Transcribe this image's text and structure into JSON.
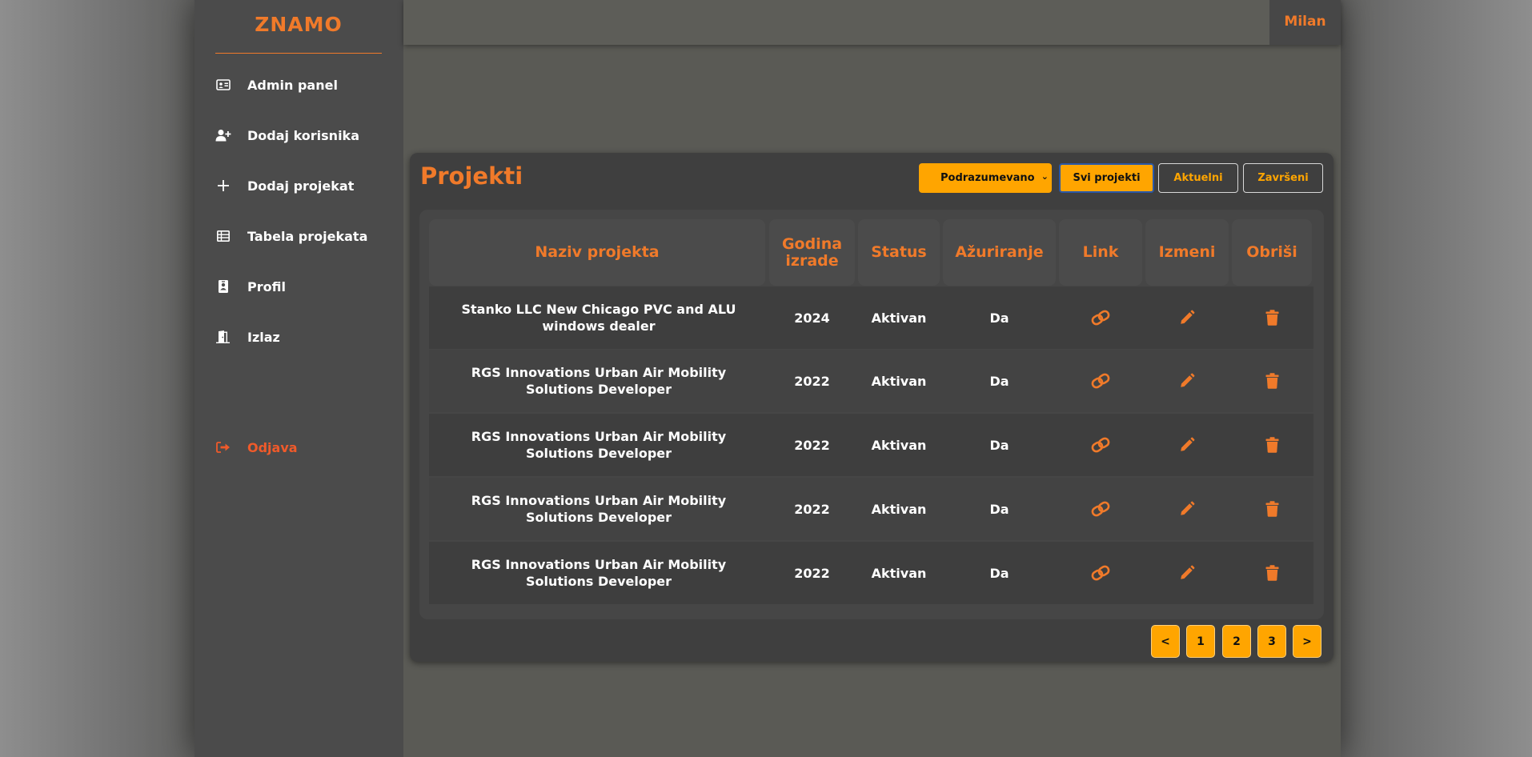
{
  "sidebar": {
    "brand": "ZNAMO",
    "items": [
      {
        "label": "Admin panel",
        "icon": "id-card-icon"
      },
      {
        "label": "Dodaj korisnika",
        "icon": "user-plus-icon"
      },
      {
        "label": "Dodaj projekat",
        "icon": "plus-icon"
      },
      {
        "label": "Tabela projekata",
        "icon": "table-list-icon"
      },
      {
        "label": "Profil",
        "icon": "id-badge-icon"
      },
      {
        "label": "Izlaz",
        "icon": "door-exit-icon"
      }
    ],
    "logout": {
      "label": "Odjava",
      "icon": "sign-out-icon"
    }
  },
  "header": {
    "user": "Milan"
  },
  "projects": {
    "title": "Projekti",
    "sort_selected": "Podrazumevano",
    "filters": [
      "Svi projekti",
      "Aktuelni",
      "Završeni"
    ],
    "active_filter": "Svi projekti",
    "columns": [
      "Naziv projekta",
      "Godina izrade",
      "Status",
      "Ažuriranje",
      "Link",
      "Izmeni",
      "Obriši"
    ],
    "rows": [
      {
        "name": "Stanko LLC New Chicago PVC and ALU windows dealer",
        "year": "2024",
        "status": "Aktivan",
        "update": "Da"
      },
      {
        "name": "RGS Innovations Urban Air Mobility Solutions Developer",
        "year": "2022",
        "status": "Aktivan",
        "update": "Da"
      },
      {
        "name": "RGS Innovations Urban Air Mobility Solutions Developer",
        "year": "2022",
        "status": "Aktivan",
        "update": "Da"
      },
      {
        "name": "RGS Innovations Urban Air Mobility Solutions Developer",
        "year": "2022",
        "status": "Aktivan",
        "update": "Da"
      },
      {
        "name": "RGS Innovations Urban Air Mobility Solutions Developer",
        "year": "2022",
        "status": "Aktivan",
        "update": "Da"
      }
    ],
    "row_icons": {
      "link": "link-icon",
      "edit": "pencil-icon",
      "delete": "trash-icon"
    },
    "pagination": {
      "prev": "<",
      "pages": [
        "1",
        "2",
        "3"
      ],
      "next": ">"
    }
  },
  "colors": {
    "accent": "#f07a2a",
    "button": "#ffa500",
    "sidebar_bg": "#4b4b4b",
    "panel_bg": "#3f3f3f",
    "logout": "#f05a2a"
  }
}
